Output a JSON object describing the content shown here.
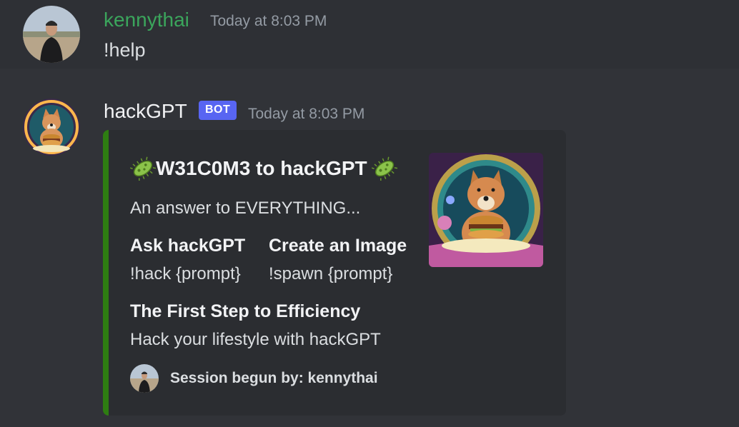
{
  "messages": [
    {
      "author": "kennythai",
      "author_color": "#3ba55c",
      "timestamp": "Today at 8:03 PM",
      "content": "!help"
    },
    {
      "author": "hackGPT",
      "author_color": "#f2f3f5",
      "badge": "BOT",
      "timestamp": "Today at 8:03 PM",
      "embed": {
        "accent_color": "#2e7d12",
        "title": "W31C0M3 to hackGPT",
        "title_icon": "microbe-icon",
        "description": "An answer to EVERYTHING...",
        "fields": [
          {
            "name": "Ask hackGPT",
            "value": "!hack {prompt}"
          },
          {
            "name": "Create an Image",
            "value": "!spawn {prompt}"
          },
          {
            "name": "The First Step to Efficiency",
            "value": "Hack your lifestyle with hackGPT"
          }
        ],
        "footer": "Session begun by: kennythai"
      }
    }
  ]
}
